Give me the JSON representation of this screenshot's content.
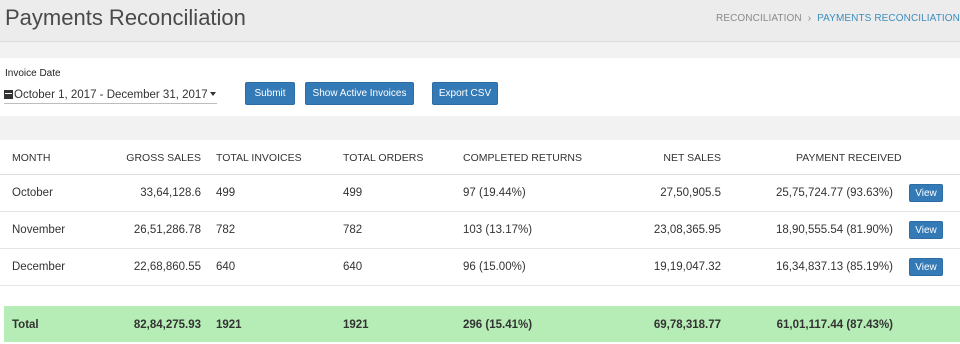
{
  "header": {
    "title": "Payments Reconciliation",
    "breadcrumb_home": "RECONCILIATION",
    "breadcrumb_separator": "›",
    "breadcrumb_current": "PAYMENTS RECONCILIATION"
  },
  "filters": {
    "invoice_date_label": "Invoice Date",
    "date_range": "October 1, 2017 - December 31, 2017",
    "calendar_icon": "calendar-icon",
    "caret_icon": "caret-down-icon",
    "submit_label": "Submit",
    "show_active_label": "Show Active Invoices",
    "export_label": "Export CSV"
  },
  "table": {
    "headers": {
      "month": "MONTH",
      "gross_sales": "GROSS SALES",
      "total_invoices": "TOTAL INVOICES",
      "total_orders": "TOTAL ORDERS",
      "completed_returns": "COMPLETED RETURNS",
      "net_sales": "NET SALES",
      "payment_received": "PAYMENT RECEIVED"
    },
    "rows": [
      {
        "month": "October",
        "gross_sales": "33,64,128.6",
        "total_invoices": "499",
        "total_orders": "499",
        "completed_returns": "97 (19.44%)",
        "net_sales": "27,50,905.5",
        "payment_received": "25,75,724.77 (93.63%)",
        "action": "View"
      },
      {
        "month": "November",
        "gross_sales": "26,51,286.78",
        "total_invoices": "782",
        "total_orders": "782",
        "completed_returns": "103 (13.17%)",
        "net_sales": "23,08,365.95",
        "payment_received": "18,90,555.54 (81.90%)",
        "action": "View"
      },
      {
        "month": "December",
        "gross_sales": "22,68,860.55",
        "total_invoices": "640",
        "total_orders": "640",
        "completed_returns": "96 (15.00%)",
        "net_sales": "19,19,047.32",
        "payment_received": "16,34,837.13 (85.19%)",
        "action": "View"
      }
    ],
    "total": {
      "month": "Total",
      "gross_sales": "82,84,275.93",
      "total_invoices": "1921",
      "total_orders": "1921",
      "completed_returns": "296 (15.41%)",
      "net_sales": "69,78,318.77",
      "payment_received": "61,01,117.44 (87.43%)"
    }
  },
  "colors": {
    "primary_button": "#337ab7",
    "total_row": "#b6ecb6",
    "breadcrumb_active": "#3c8dbc"
  }
}
